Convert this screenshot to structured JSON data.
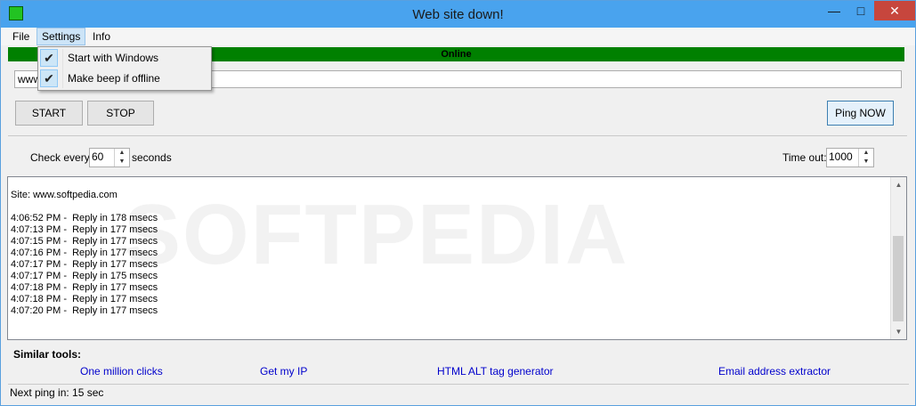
{
  "window": {
    "title": "Web site down!"
  },
  "menu": {
    "file": "File",
    "settings": "Settings",
    "info": "Info"
  },
  "settings_menu": {
    "items": [
      {
        "label": "Start with Windows",
        "checked": true
      },
      {
        "label": "Make beep if offline",
        "checked": true
      }
    ]
  },
  "status": {
    "text": "Online",
    "color": "#008000"
  },
  "url": {
    "value": "www.softpedia.com"
  },
  "buttons": {
    "start": "START",
    "stop": "STOP",
    "ping_now": "Ping NOW"
  },
  "interval": {
    "label": "Check every",
    "value": "60",
    "unit": "seconds"
  },
  "timeout": {
    "label": "Time out:",
    "value": "1000"
  },
  "log": {
    "site_line": "Site: www.softpedia.com",
    "entries": [
      "4:06:52 PM -  Reply in 178 msecs",
      "4:07:13 PM -  Reply in 177 msecs",
      "4:07:15 PM -  Reply in 177 msecs",
      "4:07:16 PM -  Reply in 177 msecs",
      "4:07:17 PM -  Reply in 177 msecs",
      "4:07:17 PM -  Reply in 175 msecs",
      "4:07:18 PM -  Reply in 177 msecs",
      "4:07:18 PM -  Reply in 177 msecs",
      "4:07:20 PM -  Reply in 177 msecs"
    ]
  },
  "similar_tools": {
    "title": "Similar tools:",
    "links": [
      "One million clicks",
      "Get my IP",
      "HTML ALT tag generator",
      "Email address extractor"
    ]
  },
  "statusbar": {
    "text": "Next ping in: 15 sec"
  },
  "watermark": "SOFTPEDIA"
}
